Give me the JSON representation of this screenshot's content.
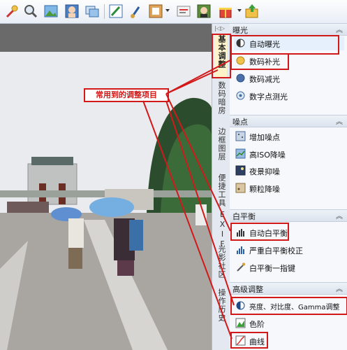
{
  "toolbar": {
    "icons": [
      "magic-wand-icon",
      "magnifier-icon",
      "image-icon",
      "portrait-icon",
      "slideshow-icon",
      "edit-pen-icon",
      "brush-icon",
      "frame-icon",
      "text-edit-icon",
      "beauty-icon",
      "gift-icon",
      "export-icon"
    ]
  },
  "tabs": {
    "items": [
      {
        "label": "基本调整",
        "active": true
      },
      {
        "label": "数码暗房",
        "active": false
      },
      {
        "label": "边框图层",
        "active": false
      },
      {
        "label": "便捷工具",
        "active": false
      },
      {
        "label": "EXIF",
        "active": false
      },
      {
        "label": "光影社区",
        "active": false
      },
      {
        "label": "操作历史",
        "active": false
      }
    ]
  },
  "panel": {
    "exposure": {
      "title": "曝光",
      "items": [
        "自动曝光",
        "数码补光",
        "数码减光",
        "数字点测光"
      ]
    },
    "noise": {
      "title": "噪点",
      "items": [
        "增加噪点",
        "高ISO降噪",
        "夜景抑噪",
        "颗粒降噪"
      ]
    },
    "wb": {
      "title": "白平衡",
      "items": [
        "自动白平衡",
        "严重白平衡校正",
        "白平衡一指键"
      ]
    },
    "advanced": {
      "title": "高级调整",
      "items": [
        "亮度、对比度、Gamma调整",
        "色阶",
        "曲线"
      ]
    },
    "collapse_glyph": "︽"
  },
  "callout": {
    "text": "常用到的调整项目"
  },
  "colors": {
    "highlight": "#d21919",
    "panel_bg": "#f6f8fb"
  }
}
